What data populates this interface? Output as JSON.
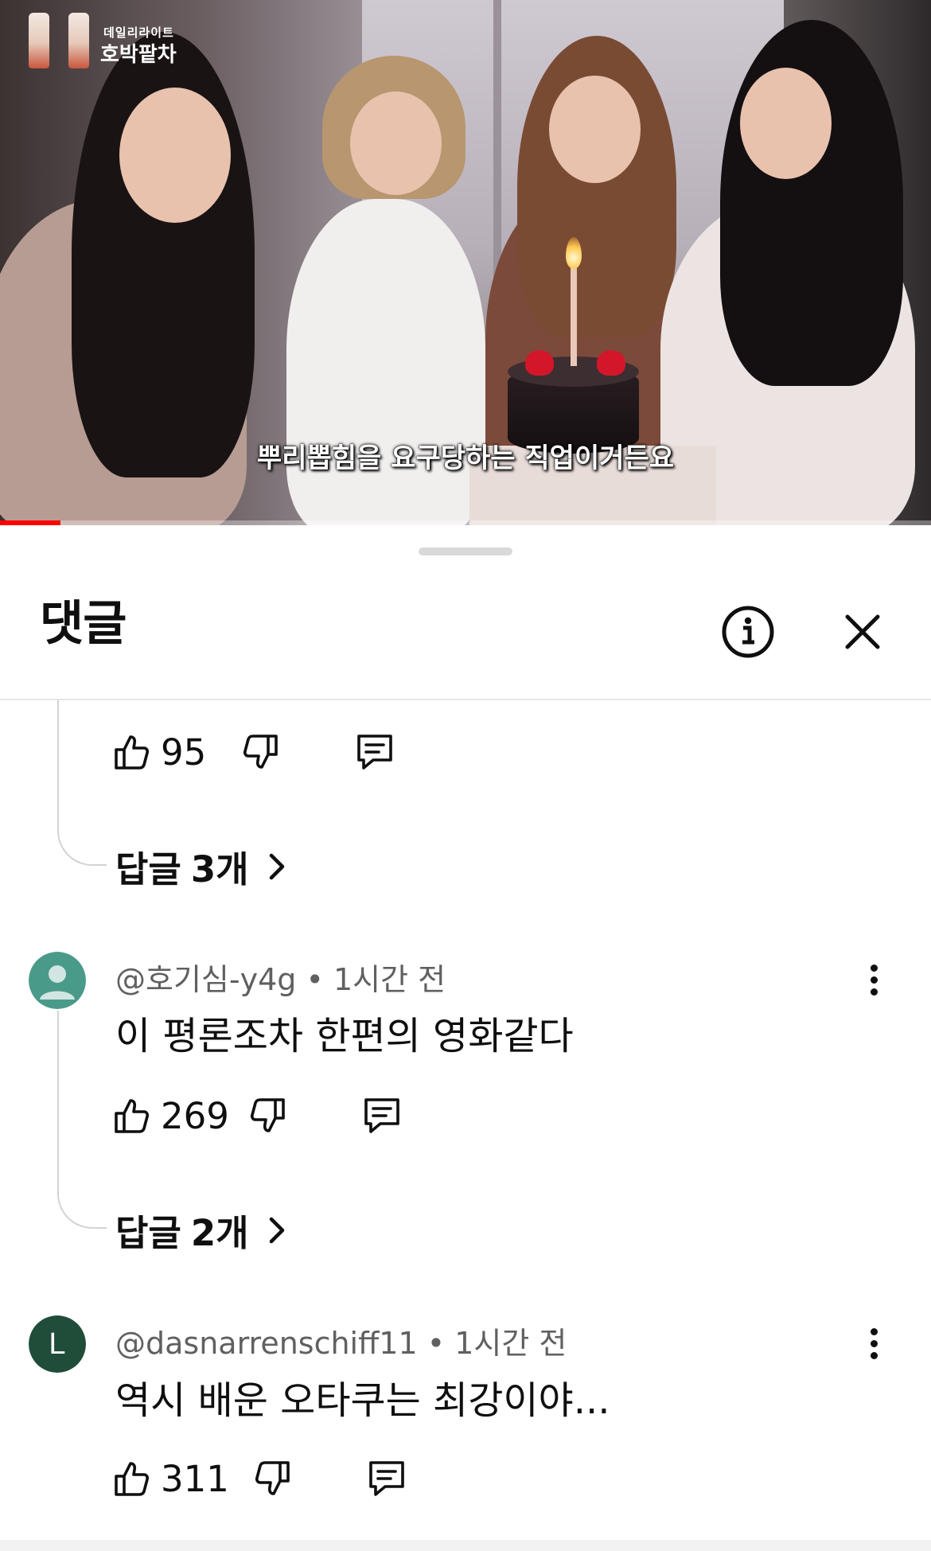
{
  "video": {
    "sponsor_small": "데일리라이트",
    "sponsor_big": "호박팥차",
    "subtitle": "뿌리뽑힘을 요구당하는 직업이거든요",
    "progress_fraction": 0.065
  },
  "sheet": {
    "title": "댓글",
    "info_icon": "info-icon",
    "close_icon": "close-icon"
  },
  "comments": [
    {
      "likes": "95",
      "reply_label": "답글",
      "reply_count": "3개"
    },
    {
      "handle": "@호기심-y4g",
      "time": "1시간 전",
      "text": "이 평론조차 한편의 영화같다",
      "likes": "269",
      "reply_label": "답글",
      "reply_count": "2개",
      "avatar_color": "#4a9a8a"
    },
    {
      "handle": "@dasnarrenschiff11",
      "time": "1시간 전",
      "text": "역시 배운 오타쿠는 최강이야...",
      "likes": "311",
      "avatar_letter": "L",
      "avatar_color": "#1f4d3a"
    }
  ],
  "colors": {
    "progress": "#ff0000",
    "text_primary": "#0f0f0f",
    "text_secondary": "#606060"
  }
}
